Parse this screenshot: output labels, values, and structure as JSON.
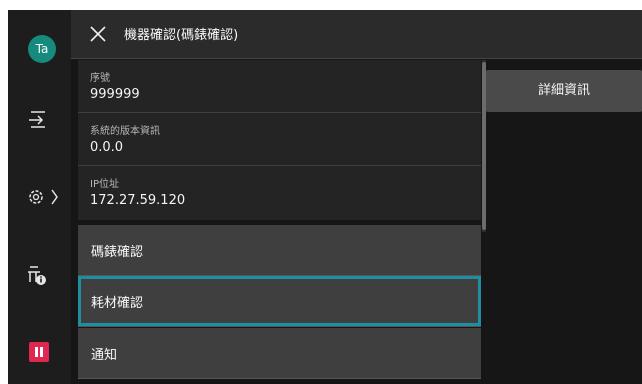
{
  "user": {
    "initials": "Ta"
  },
  "header": {
    "title": "機器確認(碼錶確認)"
  },
  "info": [
    {
      "label": "序號",
      "value": "999999"
    },
    {
      "label": "系統的版本資訊",
      "value": "0.0.0"
    },
    {
      "label": "IP位址",
      "value": "172.27.59.120"
    }
  ],
  "menu": [
    {
      "label": "碼錶確認"
    },
    {
      "label": "耗材確認"
    },
    {
      "label": "通知"
    }
  ],
  "detail": {
    "label": "詳細資訊"
  },
  "colors": {
    "accent_focus": "#1e8fa0",
    "avatar": "#178a7e",
    "pause": "#e02752"
  },
  "icons": [
    "close-icon",
    "sign-in-icon",
    "settings-gear-icon",
    "chevron-right-icon",
    "printer-info-icon",
    "pause-icon"
  ]
}
